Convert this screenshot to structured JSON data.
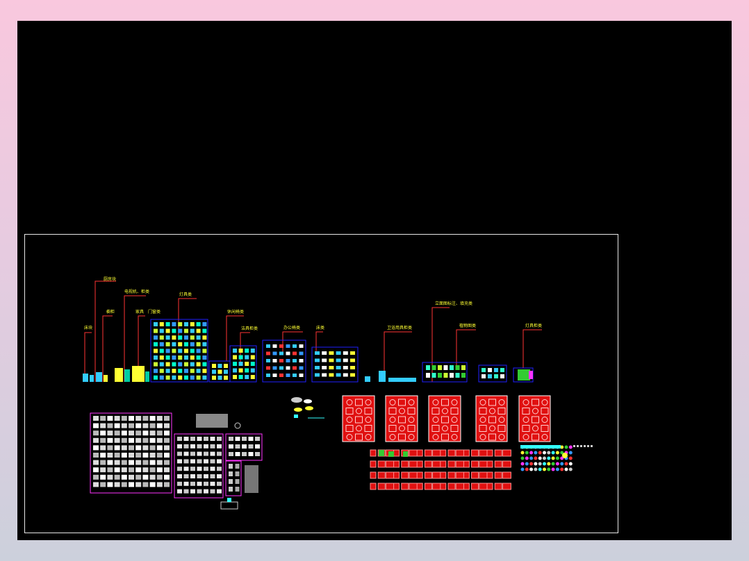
{
  "labels": {
    "l1": "床块",
    "l2": "厨房块",
    "l3": "橱柜",
    "l4": "电视机、柜类",
    "l5": "家具",
    "l6": "门窗类",
    "l7": "灯具类",
    "l8": "休闲椅类",
    "l9": "洁具柜类",
    "l10": "办公椅类",
    "l11": "床类",
    "l12": "卫浴用具柜类",
    "l13": "立面图标注、填充类",
    "l14": "植物图类",
    "l15": "灯具柜类"
  },
  "colors": {
    "background": "#000000",
    "frame": "#e8e8e8",
    "label_text": "#ffff33",
    "leader": "#ff3333",
    "group_frame": "#2020ff",
    "panel_fill": "#e01010",
    "magenta": "#ff33ff"
  }
}
